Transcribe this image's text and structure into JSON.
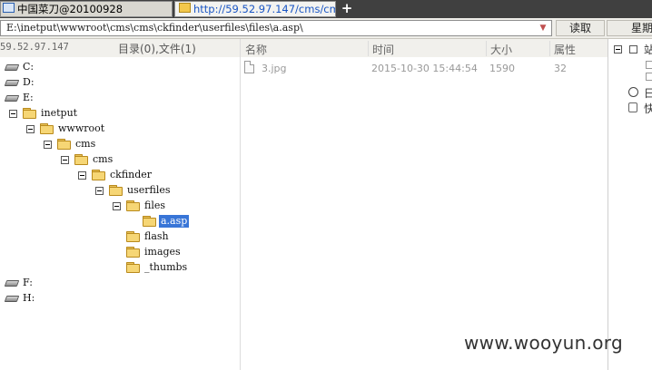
{
  "tabs": [
    {
      "label": "中国菜刀@20100928",
      "active": false
    },
    {
      "label": "http://59.52.97.147/cms/cms...",
      "active": true
    }
  ],
  "new_tab_label": "+",
  "address_value": "E:\\inetput\\wwwroot\\cms\\cms\\ckfinder\\userfiles\\files\\a.asp\\",
  "read_button_label": "读取",
  "calendar_button_label": "星期",
  "left_pane": {
    "host": "59.52.97.147",
    "counts": "目录(0),文件(1)"
  },
  "tree": [
    {
      "label": "C:",
      "type": "drive"
    },
    {
      "label": "D:",
      "type": "drive"
    },
    {
      "label": "E:",
      "type": "drive"
    },
    {
      "label": "inetput",
      "type": "folder"
    },
    {
      "label": "wwwroot",
      "type": "folder"
    },
    {
      "label": "cms",
      "type": "folder"
    },
    {
      "label": "cms",
      "type": "folder"
    },
    {
      "label": "ckfinder",
      "type": "folder"
    },
    {
      "label": "userfiles",
      "type": "folder"
    },
    {
      "label": "files",
      "type": "folder"
    },
    {
      "label": "a.asp",
      "type": "folder",
      "selected": true
    },
    {
      "label": "flash",
      "type": "folder"
    },
    {
      "label": "images",
      "type": "folder"
    },
    {
      "label": "_thumbs",
      "type": "folder"
    },
    {
      "label": "F:",
      "type": "drive"
    },
    {
      "label": "H:",
      "type": "drive"
    }
  ],
  "columns": {
    "name": "名称",
    "time": "时间",
    "size": "大小",
    "attr": "属性"
  },
  "files": [
    {
      "name": "3.jpg",
      "time": "2015-10-30 15:44:54",
      "size": "1590",
      "attr": "32"
    }
  ],
  "side_panel": {
    "row1": "站",
    "row2": "日",
    "row3": "快"
  },
  "watermark": "www.wooyun.org",
  "colors": {
    "accent": "#3875d7",
    "tab_bar": "#404040",
    "link_tab": "#1a56c4"
  }
}
